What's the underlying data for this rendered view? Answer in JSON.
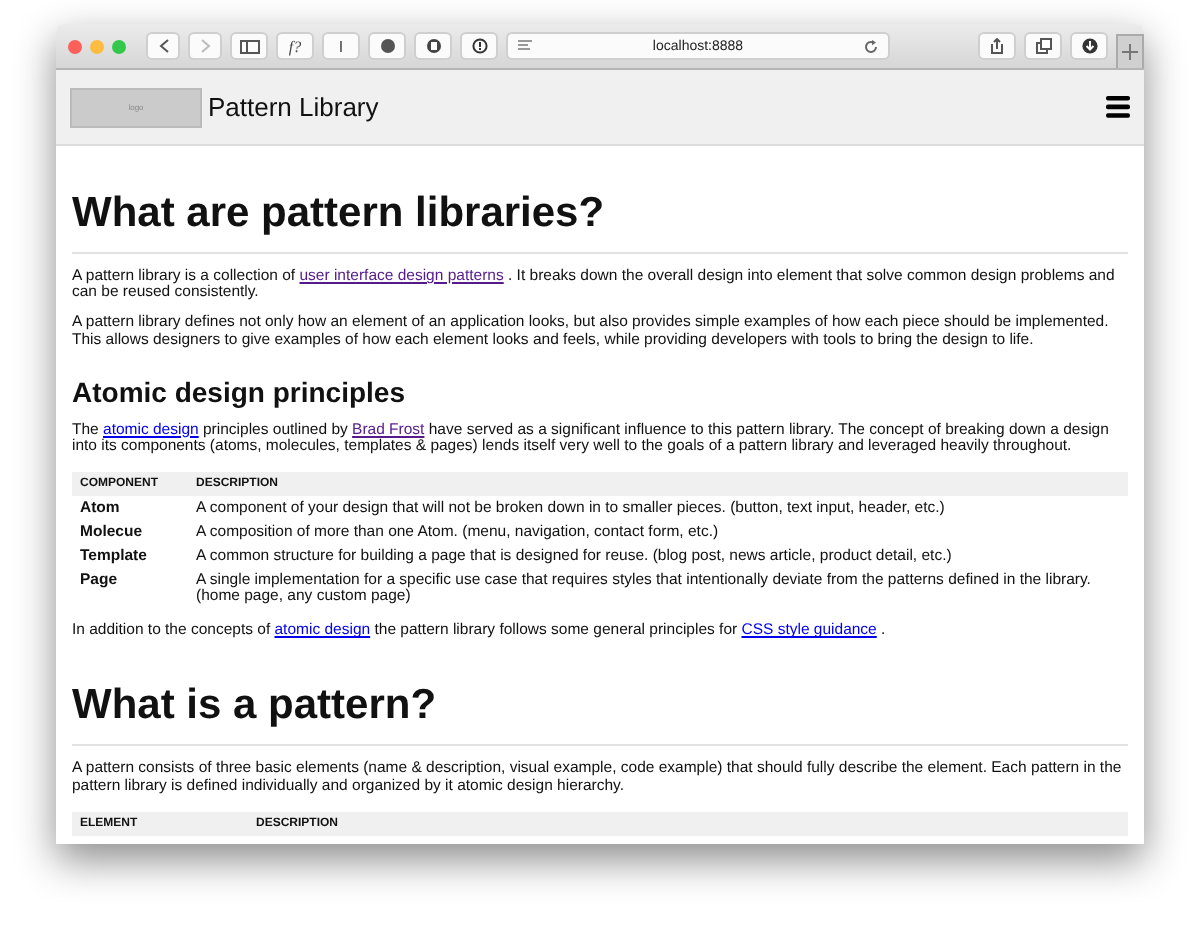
{
  "browser": {
    "url": "localhost:8888",
    "extension_labels": [
      "f?",
      "I"
    ]
  },
  "header": {
    "logo": "logo",
    "title": "Pattern Library"
  },
  "sections": [
    {
      "heading": "What are pattern libraries?",
      "kind": "title",
      "blocks": [
        {
          "kind": "paragraph",
          "parts": [
            {
              "kind": "text",
              "text": "A pattern library is a collection of "
            },
            {
              "kind": "link",
              "text": "user interface design patterns",
              "visited": true
            },
            {
              "kind": "text",
              "text": " . It breaks down the overall design into element that solve common design problems and can be reused consistently."
            }
          ]
        },
        {
          "kind": "paragraph",
          "parts": [
            {
              "kind": "text",
              "text": "A pattern library defines not only how an element of an application looks, but also provides simple examples of how each piece should be implemented. This allows designers to give examples of how each element looks and feels, while providing developers with tools to bring the design to life."
            }
          ]
        }
      ]
    },
    {
      "heading": "Atomic design principles",
      "kind": "subtitle",
      "blocks": [
        {
          "kind": "paragraph",
          "parts": [
            {
              "kind": "text",
              "text": "The "
            },
            {
              "kind": "link",
              "text": "atomic design",
              "visited": false
            },
            {
              "kind": "text",
              "text": " principles outlined by "
            },
            {
              "kind": "link",
              "text": "Brad Frost",
              "visited": true
            },
            {
              "kind": "text",
              "text": " have served as a significant influence to this pattern library. The concept of breaking down a design into its components (atoms, molecules, templates & pages) lends itself very well to the goals of a pattern library and leveraged heavily throughout."
            }
          ]
        },
        {
          "kind": "table",
          "columns": [
            "COMPONENT",
            "DESCRIPTION"
          ],
          "rows": [
            [
              "Atom",
              "A component of your design that will not be broken down in to smaller pieces. (button, text input, header, etc.)"
            ],
            [
              "Molecue",
              "A composition of more than one Atom. (menu, navigation, contact form, etc.)"
            ],
            [
              "Template",
              "A common structure for building a page that is designed for reuse. (blog post, news article, product detail, etc.)"
            ],
            [
              "Page",
              "A single implementation for a specific use case that requires styles that intentionally deviate from the patterns defined in the library. (home page, any custom page)"
            ]
          ]
        },
        {
          "kind": "paragraph",
          "parts": [
            {
              "kind": "text",
              "text": "In addition to the concepts of "
            },
            {
              "kind": "link",
              "text": "atomic design",
              "visited": false
            },
            {
              "kind": "text",
              "text": " the pattern library follows some general principles for "
            },
            {
              "kind": "link",
              "text": "CSS style guidance",
              "visited": false
            },
            {
              "kind": "text",
              "text": " ."
            }
          ]
        }
      ]
    },
    {
      "heading": "What is a pattern?",
      "kind": "title",
      "blocks": [
        {
          "kind": "paragraph",
          "parts": [
            {
              "kind": "text",
              "text": "A pattern consists of three basic elements (name & description, visual example, code example) that should fully describe the element. Each pattern in the pattern library is defined individually and organized by it atomic design hierarchy."
            }
          ]
        },
        {
          "kind": "table",
          "columns": [
            "ELEMENT",
            "DESCRIPTION"
          ]
        }
      ]
    }
  ]
}
